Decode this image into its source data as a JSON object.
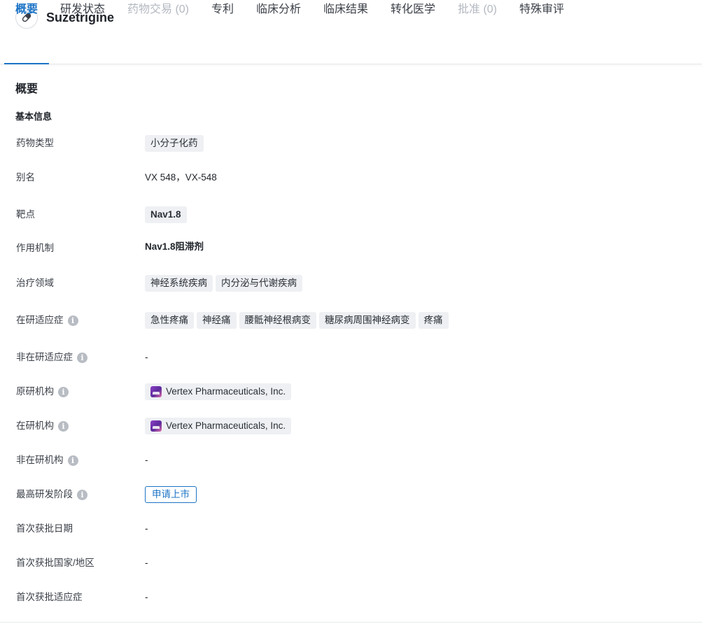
{
  "header": {
    "title": "Suzetrigine",
    "icon": "pill-icon"
  },
  "tabs": [
    {
      "label": "概要",
      "state": "active"
    },
    {
      "label": "研发状态",
      "state": "normal"
    },
    {
      "label": "药物交易 (0)",
      "state": "disabled"
    },
    {
      "label": "专利",
      "state": "normal"
    },
    {
      "label": "临床分析",
      "state": "normal"
    },
    {
      "label": "临床结果",
      "state": "normal"
    },
    {
      "label": "转化医学",
      "state": "normal"
    },
    {
      "label": "批准 (0)",
      "state": "disabled"
    },
    {
      "label": "特殊审评",
      "state": "normal"
    }
  ],
  "overview": {
    "section_title": "概要",
    "basic_info_title": "基本信息",
    "rows": {
      "drug_type": {
        "label": "药物类型",
        "tags": [
          "小分子化药"
        ]
      },
      "alias": {
        "label": "别名",
        "value": "VX 548，VX-548"
      },
      "target": {
        "label": "靶点",
        "tags": [
          "Nav1.8"
        ]
      },
      "mechanism": {
        "label": "作用机制",
        "value": "Nav1.8阻滞剂"
      },
      "therapeutic_area": {
        "label": "治疗领域",
        "tags": [
          "神经系统疾病",
          "内分泌与代谢疾病"
        ]
      },
      "active_indications": {
        "label": "在研适应症",
        "tags": [
          "急性疼痛",
          "神经痛",
          "腰骶神经根病变",
          "糖尿病周围神经病变",
          "疼痛"
        ]
      },
      "inactive_indications": {
        "label": "非在研适应症",
        "value": "-"
      },
      "originator": {
        "label": "原研机构",
        "org": "Vertex Pharmaceuticals, Inc."
      },
      "active_org": {
        "label": "在研机构",
        "org": "Vertex Pharmaceuticals, Inc."
      },
      "inactive_org": {
        "label": "非在研机构",
        "value": "-"
      },
      "highest_phase": {
        "label": "最高研发阶段",
        "stage": "申请上市"
      },
      "first_approval_date": {
        "label": "首次获批日期",
        "value": "-"
      },
      "first_approval_country": {
        "label": "首次获批国家/地区",
        "value": "-"
      },
      "first_approval_indication": {
        "label": "首次获批适应症",
        "value": "-"
      }
    }
  },
  "colors": {
    "accent": "#1d74c6",
    "disabled_tab": "#b3b8c0",
    "tag_bg": "#eef0f3",
    "info_icon": "#b8bcc3"
  }
}
